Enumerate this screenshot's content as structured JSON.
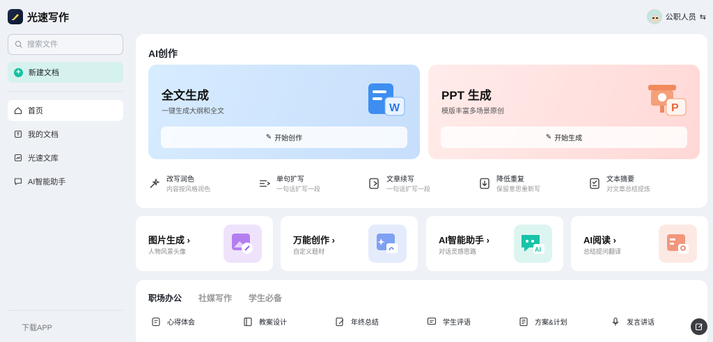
{
  "app": {
    "name": "光速写作"
  },
  "user": {
    "name": "公职人员",
    "switch_icon": "swap-icon"
  },
  "sidebar": {
    "search_placeholder": "搜索文件",
    "new_doc": "新建文档",
    "items": [
      {
        "label": "首页",
        "icon": "home-icon"
      },
      {
        "label": "我的文档",
        "icon": "doc-icon"
      },
      {
        "label": "光速文库",
        "icon": "library-icon"
      },
      {
        "label": "AI智能助手",
        "icon": "chat-icon"
      }
    ],
    "download": "下载APP"
  },
  "ai": {
    "title": "AI创作",
    "full": {
      "title": "全文生成",
      "subtitle": "一键生成大纲和全文",
      "button": "开始创作"
    },
    "ppt": {
      "title": "PPT 生成",
      "subtitle": "模版丰富多场景原创",
      "button": "开始生成"
    },
    "tools": [
      {
        "name": "改写润色",
        "desc": "内容按风格润色"
      },
      {
        "name": "单句扩写",
        "desc": "一句话扩写一段"
      },
      {
        "name": "文章续写",
        "desc": "一句话扩写一段"
      },
      {
        "name": "降低重复",
        "desc": "保留意思重新写"
      },
      {
        "name": "文本摘要",
        "desc": "对文章总结提炼"
      }
    ]
  },
  "features": [
    {
      "name": "图片生成",
      "desc": "人物风景头像",
      "color": "#efe3fb"
    },
    {
      "name": "万能创作",
      "desc": "自定义题材",
      "color": "#e4ecfc"
    },
    {
      "name": "AI智能助手",
      "desc": "对话灵感思路",
      "color": "#ddf5f1"
    },
    {
      "name": "AI阅读",
      "desc": "总结提问翻译",
      "color": "#fde9e4"
    }
  ],
  "bottom": {
    "tabs": [
      "职场办公",
      "社媒写作",
      "学生必备"
    ],
    "items": [
      "心得体会",
      "教案设计",
      "年终总结",
      "学生评语",
      "方案&计划",
      "发言讲话"
    ]
  },
  "colors": {
    "accent": "#16c0a4",
    "brand_dark": "#1b2a4a"
  }
}
